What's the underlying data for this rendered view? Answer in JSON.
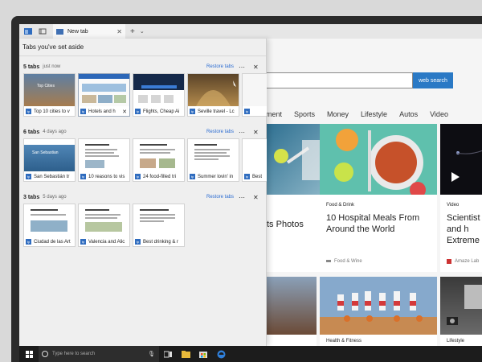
{
  "browser": {
    "active_tab": "New tab"
  },
  "aside": {
    "header": "Tabs you've set aside",
    "restore_label": "Restore tabs",
    "groups": [
      {
        "count": "5 tabs",
        "when": "just now",
        "tabs": [
          {
            "title": "Top 10 cities to v",
            "shot_text": "Top Cities"
          },
          {
            "title": "Hotels and h",
            "shot_text": ""
          },
          {
            "title": "Flights, Cheap Ai",
            "shot_text": ""
          },
          {
            "title": "Seville travel - Lc",
            "shot_text": ""
          },
          {
            "title": "",
            "shot_text": ""
          }
        ]
      },
      {
        "count": "6 tabs",
        "when": "4 days ago",
        "tabs": [
          {
            "title": "San Sebastián tr",
            "shot_text": "San Sebastian"
          },
          {
            "title": "10 reasons to vis",
            "shot_text": ""
          },
          {
            "title": "24 food-filled tri",
            "shot_text": ""
          },
          {
            "title": "Summer lovin' in",
            "shot_text": ""
          },
          {
            "title": "Best",
            "shot_text": ""
          }
        ]
      },
      {
        "count": "3 tabs",
        "when": "5 days ago",
        "tabs": [
          {
            "title": "Ciudad de las Art",
            "shot_text": ""
          },
          {
            "title": "Valencia and Alic",
            "shot_text": ""
          },
          {
            "title": "Best drinking & r",
            "shot_text": ""
          }
        ]
      }
    ]
  },
  "page": {
    "search_button": "web search",
    "nav": [
      "inment",
      "Sports",
      "Money",
      "Lifestyle",
      "Autos",
      "Video"
    ],
    "cards": [
      {
        "category": "",
        "title": "ts Photos",
        "source": ""
      },
      {
        "category": "Food & Drink",
        "title": "10 Hospital Meals From Around the World",
        "source": "Food & Wine"
      },
      {
        "category": "Video",
        "title": "Scientist net and h Extreme",
        "source": "Amaze Lab"
      },
      {
        "category": "Health & Fitness",
        "title": "",
        "source": ""
      },
      {
        "category": "Lifestyle",
        "title": "",
        "source": ""
      }
    ]
  },
  "taskbar": {
    "search_placeholder": "Type here to search"
  },
  "colors": {
    "accent": "#2a79c5",
    "restore_link": "#2a6bd1",
    "taskbar": "#1c1c1c"
  }
}
